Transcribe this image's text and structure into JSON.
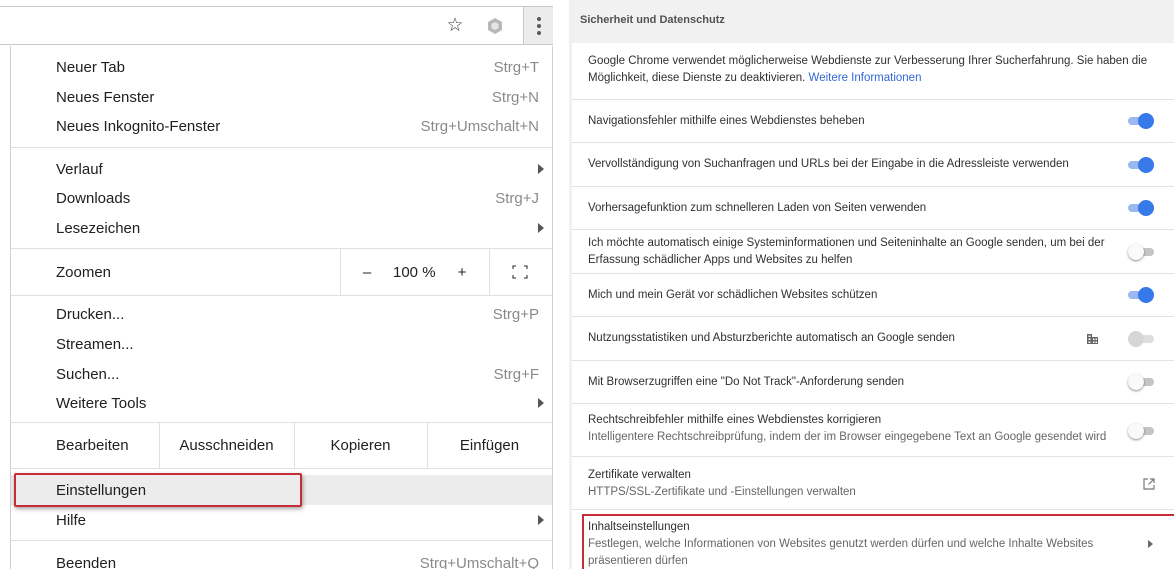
{
  "menu": {
    "groups": [
      [
        {
          "label": "Neuer Tab",
          "shortcut": "Strg+T"
        },
        {
          "label": "Neues Fenster",
          "shortcut": "Strg+N"
        },
        {
          "label": "Neues Inkognito-Fenster",
          "shortcut": "Strg+Umschalt+N"
        }
      ],
      [
        {
          "label": "Verlauf",
          "submenu": true
        },
        {
          "label": "Downloads",
          "shortcut": "Strg+J"
        },
        {
          "label": "Lesezeichen",
          "submenu": true
        }
      ]
    ],
    "zoom": {
      "label": "Zoomen",
      "minus": "–",
      "value": "100 %",
      "plus": "+",
      "fullscreen_icon": "fullscreen-icon"
    },
    "group3": [
      {
        "label": "Drucken...",
        "shortcut": "Strg+P"
      },
      {
        "label": "Streamen..."
      },
      {
        "label": "Suchen...",
        "shortcut": "Strg+F"
      },
      {
        "label": "Weitere Tools",
        "submenu": true
      }
    ],
    "edit": {
      "label": "Bearbeiten",
      "cut": "Ausschneiden",
      "copy": "Kopieren",
      "paste": "Einfügen"
    },
    "settings": {
      "label": "Einstellungen"
    },
    "help": {
      "label": "Hilfe"
    },
    "quit": {
      "label": "Beenden",
      "shortcut": "Strg+Umschalt+Q"
    },
    "highlight_color": "#c42e34"
  },
  "toolbar": {
    "icons": [
      "star-icon",
      "extension-icon",
      "menu-kebab-icon"
    ]
  },
  "settings": {
    "section_title": "Sicherheit und Datenschutz",
    "intro": {
      "text": "Google Chrome verwendet möglicherweise Webdienste zur Verbesserung Ihrer Sucherfahrung. Sie haben die Möglichkeit, diese Dienste zu deaktivieren.",
      "link": "Weitere Informationen"
    },
    "items": [
      {
        "label": "Navigationsfehler mithilfe eines Webdienstes beheben",
        "toggle": "on"
      },
      {
        "label": "Vervollständigung von Suchanfragen und URLs bei der Eingabe in die Adressleiste verwenden",
        "toggle": "on"
      },
      {
        "label": "Vorhersagefunktion zum schnelleren Laden von Seiten verwenden",
        "toggle": "on"
      },
      {
        "label": "Ich möchte automatisch einige Systeminformationen und Seiteninhalte an Google senden, um bei der Erfassung schädlicher Apps und Websites zu helfen",
        "toggle": "off"
      },
      {
        "label": "Mich und mein Gerät vor schädlichen Websites schützen",
        "toggle": "on"
      },
      {
        "label": "Nutzungsstatistiken und Absturzberichte automatisch an Google senden",
        "toggle": "disabled",
        "icon": "enterprise-icon"
      },
      {
        "label": "Mit Browserzugriffen eine \"Do Not Track\"-Anforderung senden",
        "toggle": "off"
      },
      {
        "label": "Rechtschreibfehler mithilfe eines Webdienstes korrigieren",
        "sub": "Intelligentere Rechtschreibprüfung, indem der im Browser eingegebene Text an Google gesendet wird",
        "toggle": "off"
      },
      {
        "label": "Zertifikate verwalten",
        "sub": "HTTPS/SSL-Zertifikate und -Einstellungen verwalten",
        "icon": "external-link-icon"
      },
      {
        "label": "Inhaltseinstellungen",
        "sub": "Festlegen, welche Informationen von Websites genutzt werden dürfen und welche Inhalte Websites präsentieren dürfen",
        "icon": "chevron-right-icon"
      }
    ]
  }
}
